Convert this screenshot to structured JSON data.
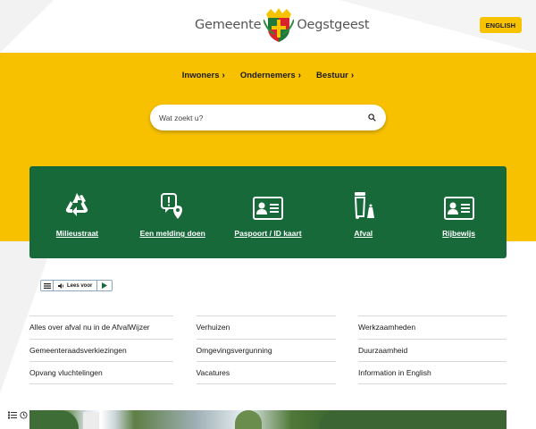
{
  "header": {
    "logo_left": "Gemeente",
    "logo_right": "Oegstgeest",
    "lang_button": "ENGLISH"
  },
  "nav": {
    "items": [
      {
        "label": "Inwoners"
      },
      {
        "label": "Ondernemers"
      },
      {
        "label": "Bestuur"
      }
    ]
  },
  "search": {
    "placeholder": "Wat zoekt u?"
  },
  "quick_links": [
    {
      "label": "Milieustraat",
      "icon": "recycle-icon"
    },
    {
      "label": "Een melding doen",
      "icon": "report-location-icon"
    },
    {
      "label": "Paspoort / ID kaart",
      "icon": "id-card-icon"
    },
    {
      "label": "Afval",
      "icon": "waste-bin-icon"
    },
    {
      "label": "Rijbewijs",
      "icon": "license-card-icon"
    }
  ],
  "readspeaker": {
    "listen_label": "Lees voor"
  },
  "links": {
    "col1": [
      "Alles over afval nu in de AfvalWijzer",
      "Gemeenteraadsverkiezingen",
      "Opvang vluchtelingen"
    ],
    "col2": [
      "Verhuizen",
      "Omgevingsvergunning",
      "Vacatures"
    ],
    "col3": [
      "Werkzaamheden",
      "Duurzaamheid",
      "Information in English"
    ]
  },
  "colors": {
    "brand_yellow": "#f8c100",
    "brand_green": "#17693a"
  }
}
